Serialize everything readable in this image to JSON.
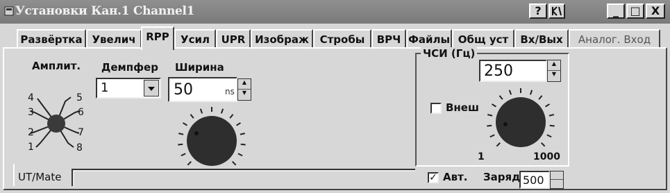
{
  "window": {
    "title": "Установки Кан.1 Channel1",
    "help_button": "?",
    "context_button": "К",
    "minimize": "_",
    "maximize": "□",
    "close": "X"
  },
  "tabs": [
    {
      "label": "Развёртка"
    },
    {
      "label": "Увелич"
    },
    {
      "label": "RPP",
      "active": true
    },
    {
      "label": "Усил"
    },
    {
      "label": "UPR"
    },
    {
      "label": "Изображ"
    },
    {
      "label": "Стробы"
    },
    {
      "label": "ВРЧ"
    },
    {
      "label": "Файлы"
    },
    {
      "label": "Общ уст"
    },
    {
      "label": "Вх/Вых"
    },
    {
      "label": "Аналог. Вход"
    }
  ],
  "amplitude": {
    "label": "Амплит.",
    "positions": [
      "1",
      "2",
      "3",
      "4",
      "5",
      "6",
      "7",
      "8"
    ]
  },
  "damper": {
    "label": "Демпфер",
    "value": "1"
  },
  "width": {
    "label": "Ширина",
    "value": "50",
    "unit": "ns"
  },
  "chsi": {
    "label": "ЧСИ (Гц)",
    "value": "250",
    "external_label": "Внеш",
    "external_checked": false,
    "scale_min": "1",
    "scale_max": "1000"
  },
  "bottom": {
    "mode_label": "UT/Mate",
    "auto_label": "Авт.",
    "auto_checked": true,
    "charge_label": "Заряд",
    "charge_value": "500"
  },
  "colors": {
    "titlebar": "#858585",
    "panel": "#d7d7d7",
    "knob": "#2e2e2e"
  }
}
